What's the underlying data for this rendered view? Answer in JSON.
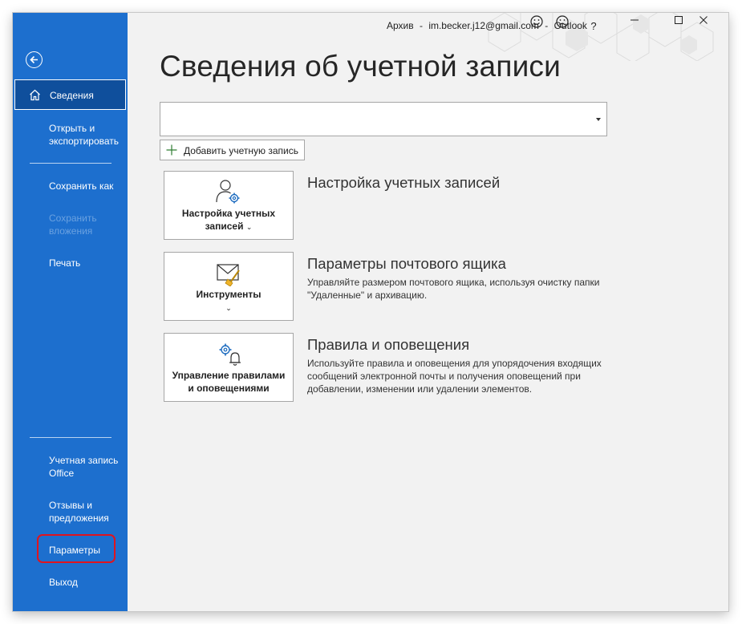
{
  "window": {
    "title_parts": [
      "Архив",
      "im.becker.j12@gmail.com",
      "Outlook"
    ],
    "title_separator": "-",
    "buttons": [
      "smiley-icon",
      "frown-icon",
      "help-icon",
      "minimize-icon",
      "maximize-icon",
      "close-icon"
    ],
    "help_label": "?"
  },
  "colors": {
    "sidebar": "#1d6fce",
    "selected": "#0f4f9c",
    "highlight": "#e0141e",
    "background": "#f2f2f2"
  },
  "sidebar": {
    "back_icon": "back-arrow-icon",
    "items": [
      {
        "label": "Сведения",
        "icon": "home-icon",
        "selected": true
      },
      {
        "label": "Открыть и экспортировать"
      },
      {
        "label": "Сохранить как"
      },
      {
        "label": "Сохранить вложения",
        "disabled": true
      },
      {
        "label": "Печать"
      },
      {
        "label": "Учетная запись Office"
      },
      {
        "label": "Отзывы и предложения"
      },
      {
        "label": "Параметры",
        "highlighted": true
      },
      {
        "label": "Выход"
      }
    ]
  },
  "main": {
    "title": "Сведения об учетной записи",
    "account_select": {
      "value": ""
    },
    "add_account": "Добавить учетную запись",
    "sections": [
      {
        "button": "Настройка учетных записей",
        "button_icon": "account-settings-icon",
        "title": "Настройка учетных записей",
        "description": ""
      },
      {
        "button": "Инструменты",
        "button_icon": "mailbox-tools-icon",
        "title": "Параметры почтового ящика",
        "description": "Управляйте размером почтового ящика, используя очистку папки \"Удаленные\" и архивацию."
      },
      {
        "button": "Управление правилами и оповещениями",
        "button_icon": "rules-alerts-icon",
        "title": "Правила и оповещения",
        "description": "Используйте правила и оповещения для упорядочения входящих сообщений электронной почты и получения оповещений при добавлении, изменении или удалении элементов."
      }
    ]
  }
}
